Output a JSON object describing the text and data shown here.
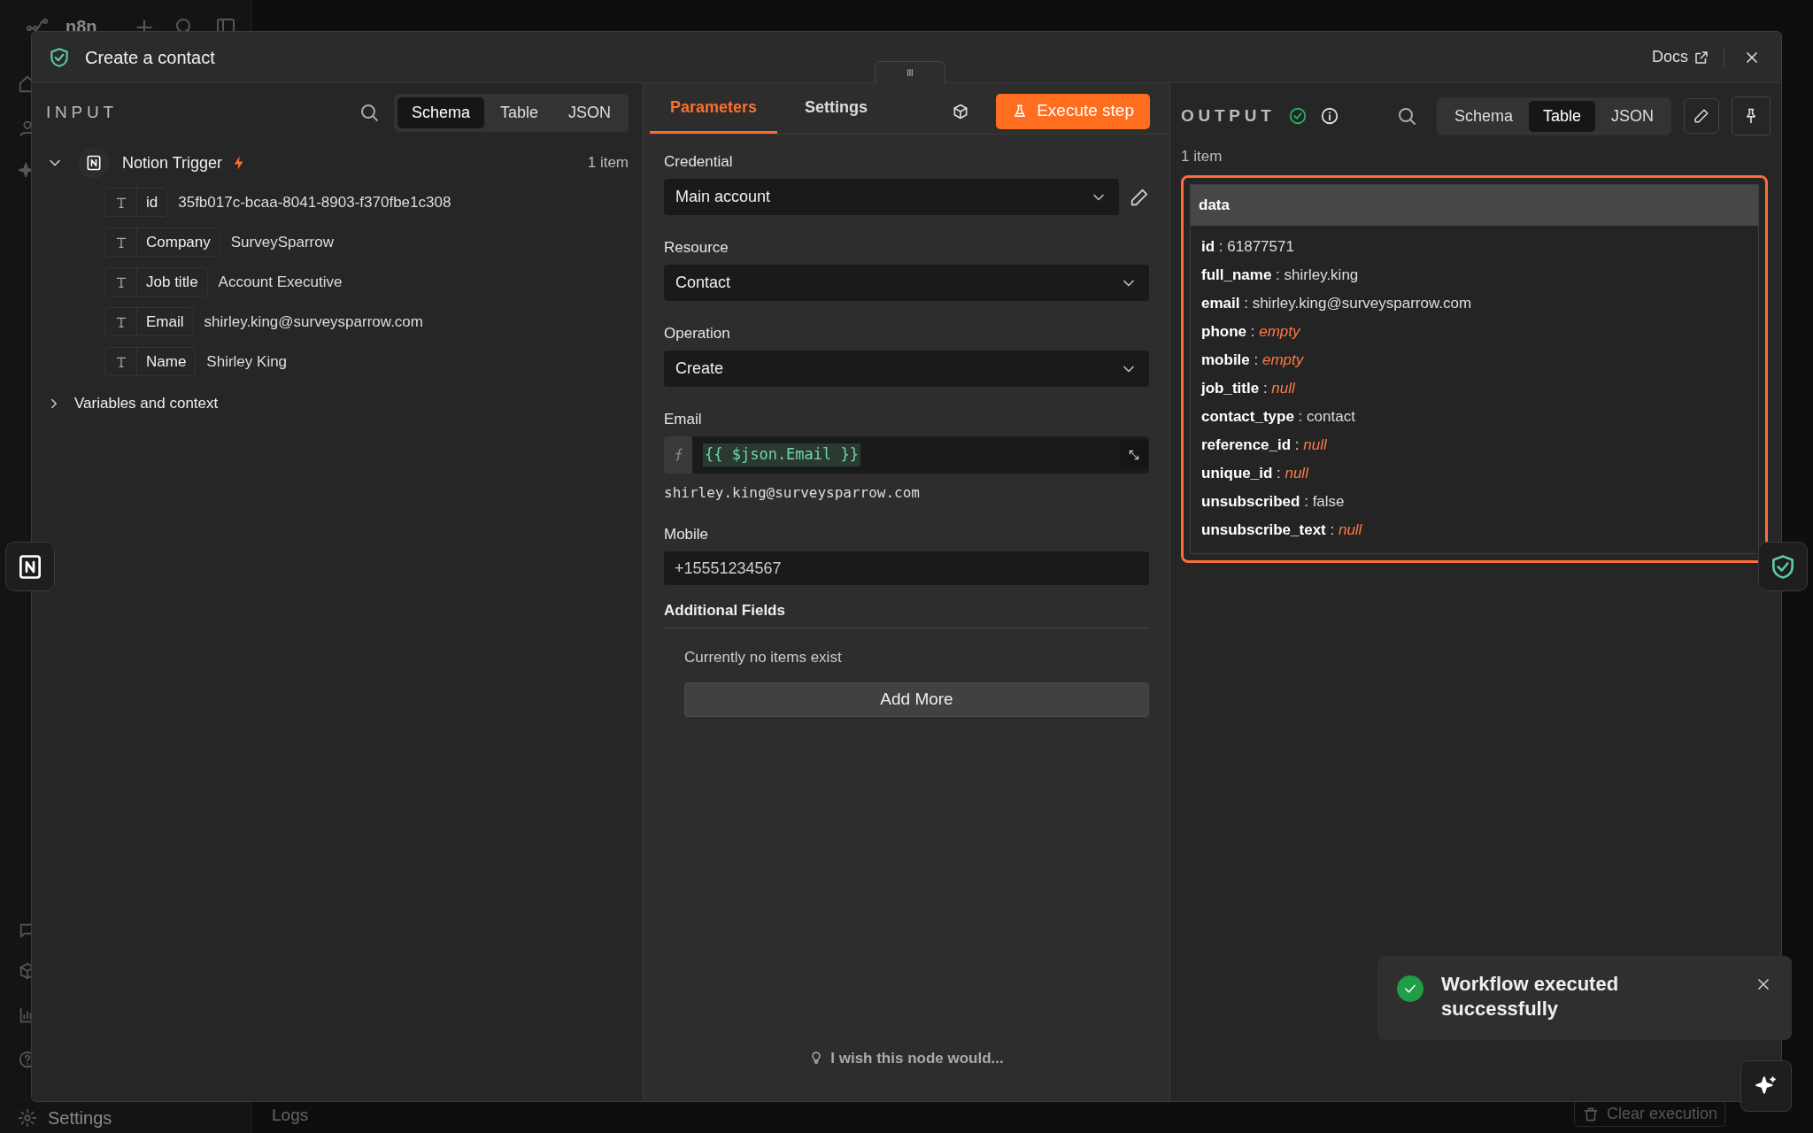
{
  "app": {
    "logo": "n8n",
    "settings": "Settings",
    "logs": "Logs",
    "clear_execution": "Clear execution"
  },
  "modal": {
    "title": "Create a contact",
    "docs": "Docs"
  },
  "input": {
    "title": "INPUT",
    "views": [
      {
        "label": "Schema",
        "selected": true
      },
      {
        "label": "Table",
        "selected": false
      },
      {
        "label": "JSON",
        "selected": false
      }
    ],
    "node": {
      "name": "Notion Trigger",
      "count": "1 item",
      "expanded": true,
      "fields": [
        {
          "key": "id",
          "value": "35fb017c-bcaa-8041-8903-f370fbe1c308"
        },
        {
          "key": "Company",
          "value": "SurveySparrow"
        },
        {
          "key": "Job title",
          "value": "Account Executive"
        },
        {
          "key": "Email",
          "value": "shirley.king@surveysparrow.com"
        },
        {
          "key": "Name",
          "value": "Shirley King"
        }
      ]
    },
    "variables": {
      "label": "Variables and context",
      "expanded": false
    }
  },
  "parameters": {
    "tabs": [
      {
        "label": "Parameters",
        "selected": true
      },
      {
        "label": "Settings",
        "selected": false
      }
    ],
    "execute": "Execute step",
    "fields": [
      {
        "kind": "select",
        "label": "Credential",
        "value": "Main account",
        "editable": true
      },
      {
        "kind": "select",
        "label": "Resource",
        "value": "Contact",
        "editable": false
      },
      {
        "kind": "select",
        "label": "Operation",
        "value": "Create",
        "editable": false
      },
      {
        "kind": "expression",
        "label": "Email",
        "value": "{{ $json.Email }}",
        "preview": "shirley.king@surveysparrow.com"
      },
      {
        "kind": "text",
        "label": "Mobile",
        "value": "+15551234567"
      }
    ],
    "additional": {
      "title": "Additional Fields",
      "empty": "Currently no items exist",
      "button": "Add More"
    },
    "feedback": "I wish this node would..."
  },
  "output": {
    "title": "OUTPUT",
    "views": [
      {
        "label": "Schema",
        "selected": false
      },
      {
        "label": "Table",
        "selected": true
      },
      {
        "label": "JSON",
        "selected": false
      }
    ],
    "count": "1 item",
    "table": {
      "column": "data",
      "rows": [
        {
          "text": "**id** : 61877571"
        },
        {
          "text": "**full_name** : shirley.king"
        },
        {
          "text": "**email** : shirley.king@surveysparrow.com"
        },
        {
          "text": "**phone** : *empty*"
        },
        {
          "text": "**mobile** : *empty*"
        },
        {
          "text": "**job_title** : *null*"
        },
        {
          "text": "**contact_type** : contact"
        },
        {
          "text": "**reference_id** : *null*"
        },
        {
          "text": "**unique_id** : *null*"
        },
        {
          "text": "**unsubscribed** : false"
        },
        {
          "text": "**unsubscribe_text** : *null*"
        }
      ]
    }
  },
  "toast": {
    "message": "Workflow executed successfully"
  }
}
